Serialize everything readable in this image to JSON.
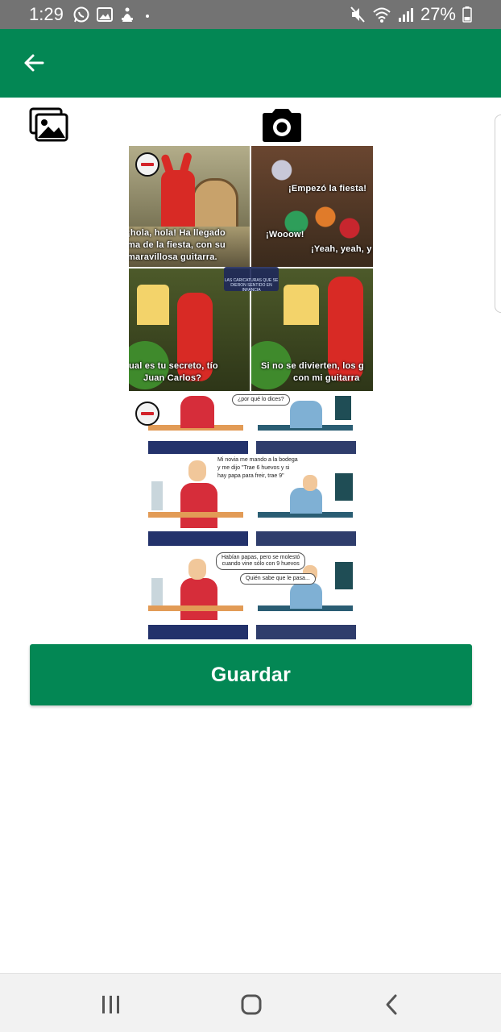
{
  "status_bar": {
    "time": "1:29",
    "battery": "27%",
    "icons": [
      "whatsapp-icon",
      "gallery-notification-icon",
      "accessibility-icon",
      "dot-icon",
      "mute-icon",
      "wifi-icon",
      "signal-icon",
      "battery-icon"
    ]
  },
  "app_bar": {
    "background": "#038754",
    "back_icon": "arrow-left-icon"
  },
  "toolbar": {
    "gallery_icon": "gallery-icon",
    "camera_icon": "camera-icon"
  },
  "images": {
    "meme1": {
      "panels": [
        {
          "lines": [
            "¡hola, hola! Ha llegado",
            "ma de la fiesta, con su",
            "maravillosa guitarra."
          ]
        },
        {
          "lines": [
            "¡Empezó la fiesta!",
            "¡Wooow!",
            "¡Yeah, yeah, y"
          ]
        },
        {
          "lines": [
            "ual es tu secreto, tío",
            "Juan Carlos?"
          ]
        },
        {
          "lines": [
            "Si no se divierten, los g",
            "con mi guitarra"
          ]
        }
      ],
      "center_badge": "LAS CARICATURAS QUE SE DIERON SENTIDO EN INFANCIA"
    },
    "meme2": {
      "rows": [
        {
          "bubbles": [
            "¿por qué lo dices?"
          ]
        },
        {
          "bubbles": [
            "Mi novia me mando a la bodega",
            "y me dijo \"Trae 6 huevos y si",
            "hay papa para freir, trae 9\""
          ]
        },
        {
          "bubbles": [
            "Habían papas, pero se molestó",
            "cuando vine sólo con 9 huevos",
            "Quién sabe que le pasa..."
          ]
        }
      ]
    }
  },
  "save_button": {
    "label": "Guardar",
    "color": "#038754"
  },
  "nav_bar": {
    "icons": [
      "recents-icon",
      "home-icon",
      "back-icon"
    ]
  }
}
